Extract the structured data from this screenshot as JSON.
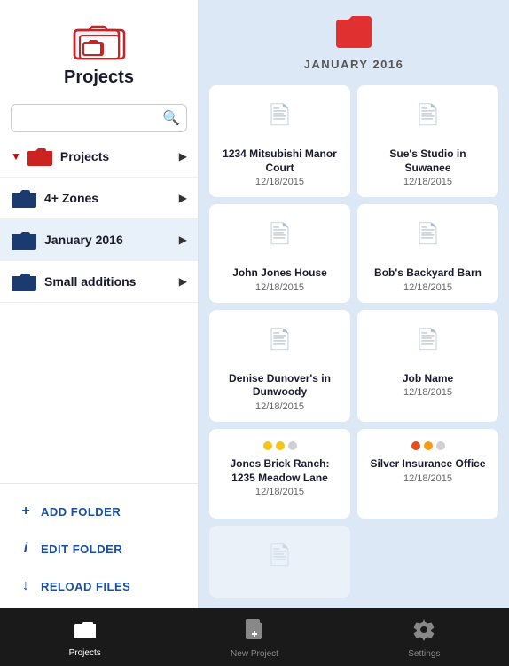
{
  "sidebar": {
    "title": "Projects",
    "search": {
      "placeholder": "",
      "value": ""
    },
    "nav_items": [
      {
        "id": "projects",
        "label": "Projects",
        "has_dropdown": true,
        "has_arrow": true,
        "active": false
      },
      {
        "id": "4zones",
        "label": "4+ Zones",
        "has_dropdown": false,
        "has_arrow": true,
        "active": false
      },
      {
        "id": "jan2016",
        "label": "January 2016",
        "has_dropdown": false,
        "has_arrow": true,
        "active": true
      },
      {
        "id": "smalladd",
        "label": "Small additions",
        "has_dropdown": false,
        "has_arrow": true,
        "active": false
      }
    ],
    "actions": [
      {
        "id": "add-folder",
        "icon": "+",
        "label": "ADD FOLDER"
      },
      {
        "id": "edit-folder",
        "icon": "i",
        "label": "EDIT FOLDER"
      },
      {
        "id": "reload-files",
        "icon": "↓",
        "label": "RELOAD FILES"
      }
    ]
  },
  "main": {
    "folder_title": "JANUARY 2016",
    "grid_items": [
      {
        "id": "item1",
        "name": "1234 Mitsubishi Manor Court",
        "date": "12/18/2015",
        "has_dots": false
      },
      {
        "id": "item2",
        "name": "Sue's Studio in Suwanee",
        "date": "12/18/2015",
        "has_dots": false
      },
      {
        "id": "item3",
        "name": "John Jones House",
        "date": "12/18/2015",
        "has_dots": false
      },
      {
        "id": "item4",
        "name": "Bob's Backyard Barn",
        "date": "12/18/2015",
        "has_dots": false
      },
      {
        "id": "item5",
        "name": "Denise Dunover's in Dunwoody",
        "date": "12/18/2015",
        "has_dots": false
      },
      {
        "id": "item6",
        "name": "Job Name",
        "date": "12/18/2015",
        "has_dots": false
      },
      {
        "id": "item7",
        "name": "Jones Brick Ranch: 1235 Meadow Lane",
        "date": "12/18/2015",
        "has_dots": true,
        "dots": [
          "yellow",
          "yellow",
          "gray"
        ]
      },
      {
        "id": "item8",
        "name": "Silver Insurance Office",
        "date": "12/18/2015",
        "has_dots": true,
        "dots": [
          "red",
          "orange",
          "gray"
        ]
      },
      {
        "id": "item9",
        "name": "",
        "date": "",
        "has_dots": false,
        "partial": true
      }
    ]
  },
  "tab_bar": {
    "items": [
      {
        "id": "projects",
        "label": "Projects",
        "active": true
      },
      {
        "id": "new-project",
        "label": "New Project",
        "active": false
      },
      {
        "id": "settings",
        "label": "Settings",
        "active": false
      }
    ]
  }
}
